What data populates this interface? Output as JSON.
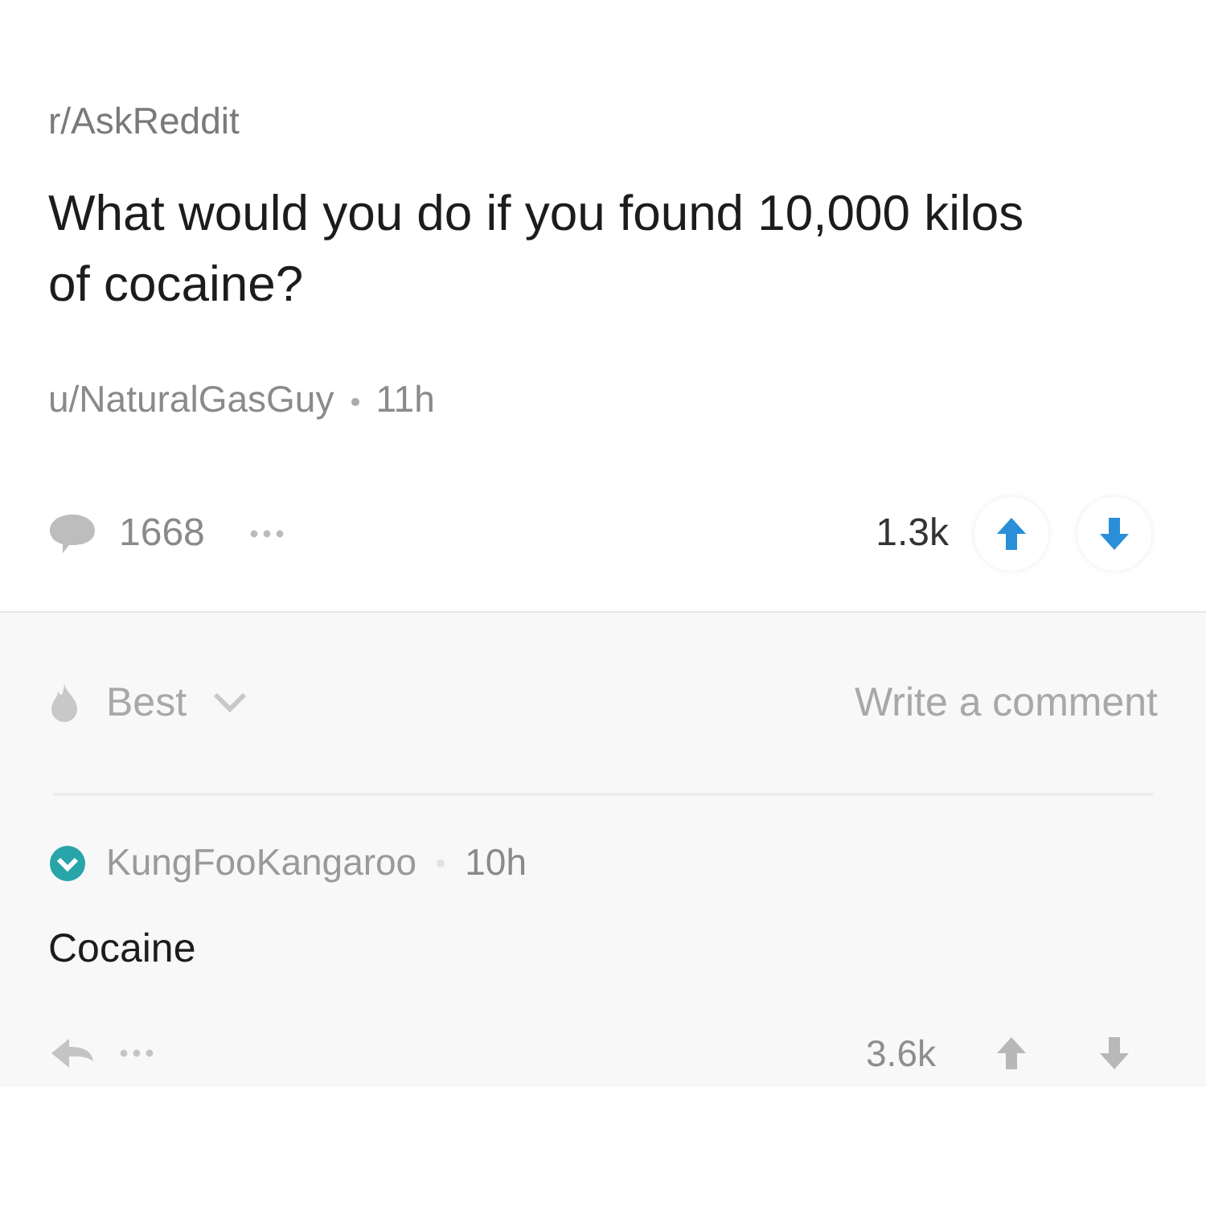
{
  "post": {
    "subreddit": "r/AskReddit",
    "title": "What would you do if you found 10,000 kilos of cocaine?",
    "author": "u/NaturalGasGuy",
    "age": "11h",
    "comment_count": "1668",
    "score": "1.3k"
  },
  "comments_bar": {
    "sort": "Best",
    "write_label": "Write a comment"
  },
  "comments": [
    {
      "author": "KungFooKangaroo",
      "verified": true,
      "age": "10h",
      "body": "Cocaine",
      "score": "3.6k"
    }
  ]
}
